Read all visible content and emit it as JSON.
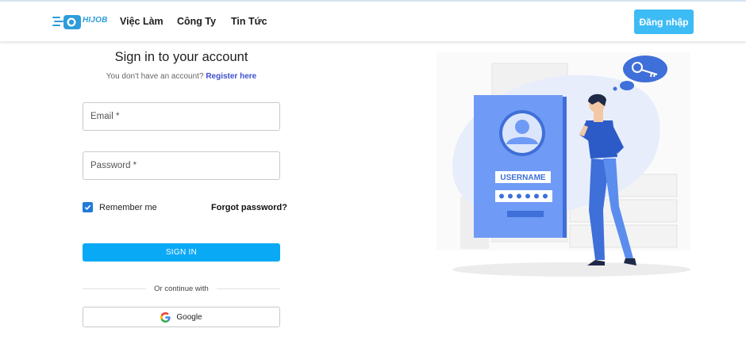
{
  "header": {
    "logo_text": "HIJOB",
    "nav": [
      "Việc Làm",
      "Công Ty",
      "Tin Tức"
    ],
    "login_button": "Đăng nhập"
  },
  "form": {
    "title": "Sign in to your account",
    "subtitle_prefix": "You don't have an account?",
    "register_link": "Register here",
    "email_placeholder": "Email *",
    "password_placeholder": "Password *",
    "remember_label": "Remember me",
    "remember_checked": true,
    "forgot_label": "Forgot password?",
    "signin_button": "SIGN IN",
    "divider_text": "Or continue with",
    "google_button": "Google"
  },
  "illustration": {
    "username_label": "USERNAME"
  },
  "colors": {
    "accent": "#3dbbf5",
    "primary_button": "#0aa9f6",
    "link": "#3e4fcf",
    "illustration_blue": "#5b8def"
  }
}
